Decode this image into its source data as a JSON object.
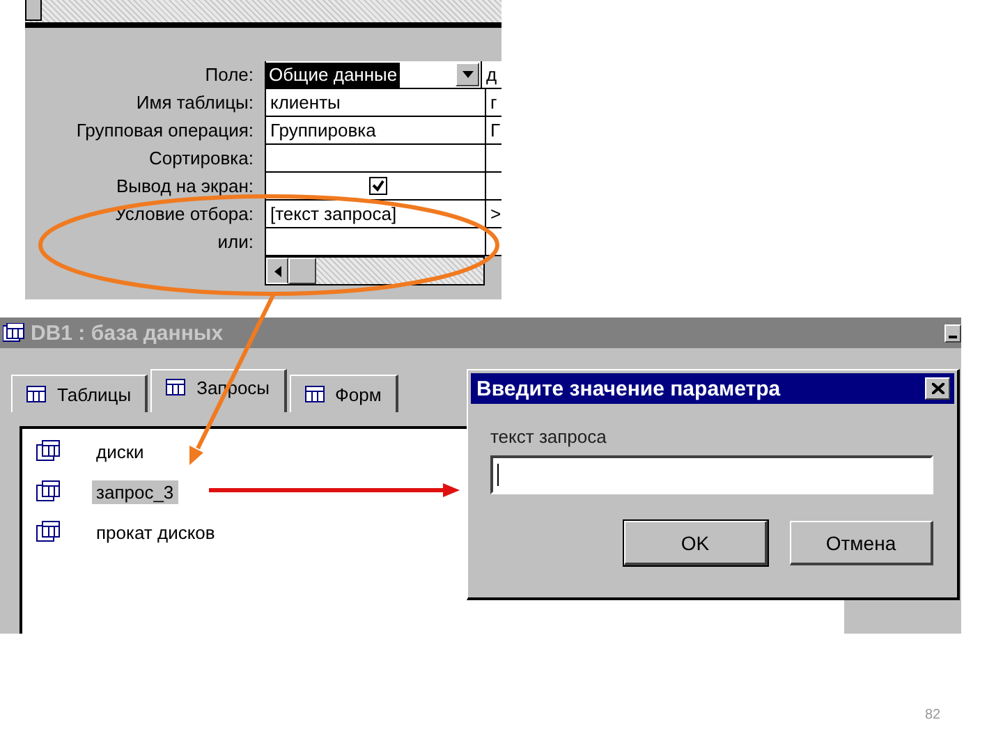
{
  "query_design": {
    "rows": [
      {
        "label": "Поле:",
        "kind": "dropdown",
        "value": "Общие данные",
        "value_2": "д"
      },
      {
        "label": "Имя таблицы:",
        "kind": "text",
        "value": "клиенты",
        "value_2": "г"
      },
      {
        "label": "Групповая операция:",
        "kind": "text",
        "value": "Группировка",
        "value_2": "Г"
      },
      {
        "label": "Сортировка:",
        "kind": "text"
      },
      {
        "label": "Вывод на экран:",
        "kind": "checkbox",
        "checked": true
      },
      {
        "label": "Условие отбора:",
        "kind": "text",
        "value": "[текст запроса]",
        "value_2": ">"
      },
      {
        "label": "или:",
        "kind": "text"
      }
    ]
  },
  "database_window": {
    "title": "DB1 : база данных",
    "tabs": [
      {
        "label": "Таблицы",
        "selected": false
      },
      {
        "label": "Запросы",
        "selected": true
      },
      {
        "label": "Форм",
        "selected": false
      }
    ],
    "items": [
      {
        "name": "диски",
        "selected": false
      },
      {
        "name": "запрос_3",
        "selected": true
      },
      {
        "name": "прокат дисков",
        "selected": false
      }
    ]
  },
  "dialog": {
    "title": "Введите значение параметра",
    "prompt": "текст запроса",
    "buttons": [
      "OK",
      "Отмена"
    ]
  },
  "page_number": "82"
}
